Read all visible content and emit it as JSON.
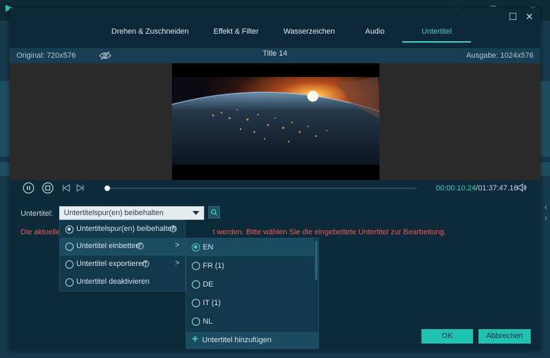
{
  "tabs": [
    {
      "label": "Drehen & Zuschneiden"
    },
    {
      "label": "Effekt & Filter"
    },
    {
      "label": "Wasserzeichen"
    },
    {
      "label": "Audio"
    },
    {
      "label": "Untertitel",
      "active": true
    }
  ],
  "info": {
    "original": "Original: 720x576",
    "title": "Title 14",
    "output": "Ausgabe: 1024x576"
  },
  "playback": {
    "time_current": "00:00:10.24",
    "time_separator": "/",
    "time_total": "01:37:47.16",
    "progress": 0.003
  },
  "subtitle": {
    "label": "Untertitel:",
    "selected": "Untertitelspur(en) beibehalten",
    "warning": "Die aktuelle",
    "warning_rest": "t werden. Bitte wählen Sie die eingebettete Untertitel zur Bearbeitung."
  },
  "menu": {
    "items": [
      {
        "label": "Untertitelspur(en) beibehalten",
        "checked": true,
        "help": true,
        "submenu": false
      },
      {
        "label": "Untertitel einbetten",
        "checked": false,
        "help": true,
        "submenu": true,
        "highlighted": true
      },
      {
        "label": "Untertitel exportieren",
        "checked": false,
        "help": true,
        "submenu": true
      },
      {
        "label": "Untertitel deaktivieren",
        "checked": false,
        "help": false,
        "submenu": false
      }
    ]
  },
  "languages": {
    "items": [
      {
        "label": "EN",
        "checked": true
      },
      {
        "label": "FR (1)",
        "checked": false
      },
      {
        "label": "DE",
        "checked": false
      },
      {
        "label": "IT (1)",
        "checked": false
      },
      {
        "label": "NL",
        "checked": false
      }
    ],
    "add_label": "Untertitel hinzufügen"
  },
  "buttons": {
    "ok": "OK",
    "cancel": "Abbrechen"
  },
  "colors": {
    "accent": "#3ed3c2",
    "warning": "#ee5a50",
    "dialog_bg": "#0c2839"
  }
}
